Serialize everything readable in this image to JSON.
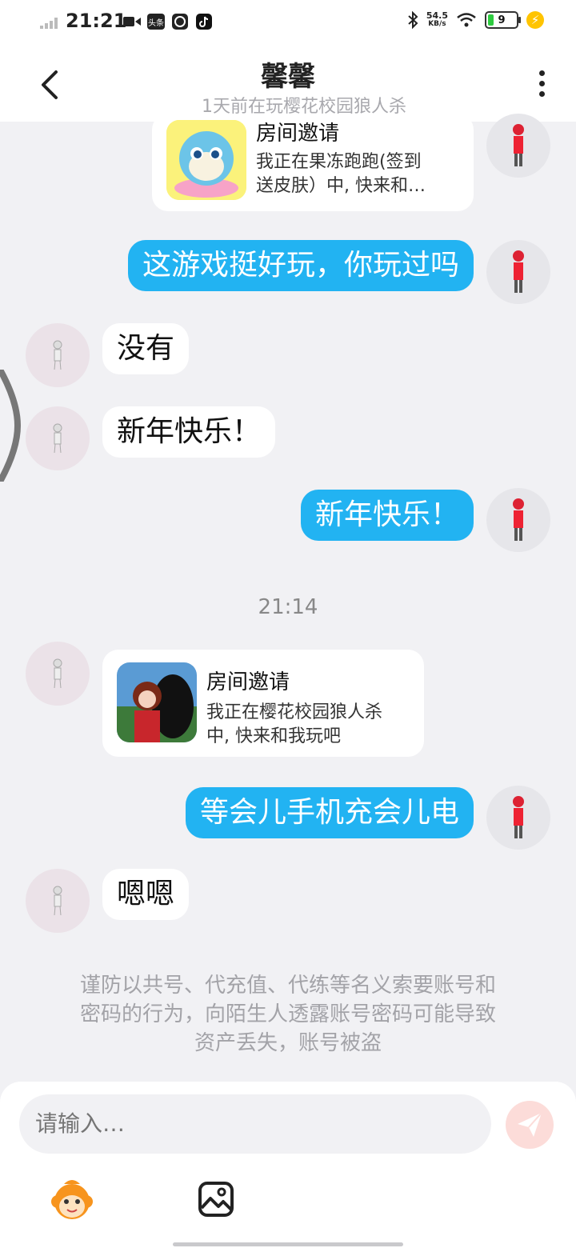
{
  "status_bar": {
    "time": "21:21",
    "icons": [
      "signal-icon",
      "video-icon",
      "toutiao-icon",
      "qq-icon",
      "tiktok-icon"
    ],
    "toutiao_label": "头条",
    "net_speed_value": "54.5",
    "net_speed_unit": "KB/s",
    "battery_level": "9"
  },
  "header": {
    "title": "馨馨",
    "subtitle": "1天前在玩樱花校园狼人杀"
  },
  "messages": {
    "card1": {
      "title": "房间邀请",
      "desc_line1": "我正在果冻跑跑(签到",
      "desc_line2": "送皮肤）中, 快来和…"
    },
    "m1": "这游戏挺好玩，你玩过吗",
    "m2": "没有",
    "m3": "新年快乐！",
    "m4": "新年快乐！",
    "timestamp": "21:14",
    "card2": {
      "title": "房间邀请",
      "desc_line1": "我正在樱花校园狼人杀",
      "desc_line2": "中, 快来和我玩吧"
    },
    "m5": "等会儿手机充会儿电",
    "m6": "嗯嗯"
  },
  "notice": {
    "line1": "谨防以共号、代充值、代练等名义索要账号和",
    "line2": "密码的行为，向陌生人透露账号密码可能导致",
    "line3": "资产丢失，账号被盗"
  },
  "input": {
    "placeholder": "请输入…"
  },
  "colors": {
    "outgoing_bubble": "#22b3f2",
    "incoming_bubble": "#ffffff",
    "background": "#f1f1f4",
    "send_button": "#fcdcd9"
  }
}
